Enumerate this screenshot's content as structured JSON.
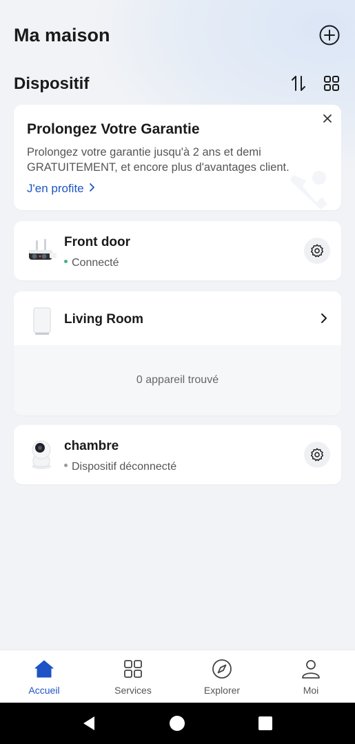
{
  "header": {
    "title": "Ma maison",
    "add_icon": "add-circle-icon"
  },
  "section": {
    "title": "Dispositif",
    "sort_icon": "sort-icon",
    "layout_icon": "grid-view-icon"
  },
  "promo": {
    "title": "Prolongez Votre Garantie",
    "text": "Prolongez votre garantie jusqu'à 2 ans et demi GRATUITEMENT,  et encore plus d'avantages client.",
    "link": "J'en profite",
    "link_color": "#1d53c4",
    "close_icon": "close-icon"
  },
  "devices": [
    {
      "name": "Front door",
      "status": "Connecté",
      "status_color": "#3fb37f",
      "image": "outdoor-camera"
    },
    {
      "name": "chambre",
      "status": "Dispositif déconnecté",
      "status_color": "#9a9a9a",
      "image": "pan-tilt-camera"
    }
  ],
  "room": {
    "name": "Living Room",
    "image": "hub-station",
    "empty_text": "0 appareil trouvé"
  },
  "tabs": [
    {
      "label": "Accueil",
      "icon": "home-icon",
      "active": true
    },
    {
      "label": "Services",
      "icon": "apps-icon",
      "active": false
    },
    {
      "label": "Explorer",
      "icon": "compass-icon",
      "active": false
    },
    {
      "label": "Moi",
      "icon": "user-icon",
      "active": false
    }
  ],
  "system_nav": {
    "back": "back-triangle-icon",
    "home": "home-circle-icon",
    "recents": "recents-square-icon"
  },
  "colors": {
    "accent": "#1d53c4",
    "background": "#f1f3f6"
  }
}
